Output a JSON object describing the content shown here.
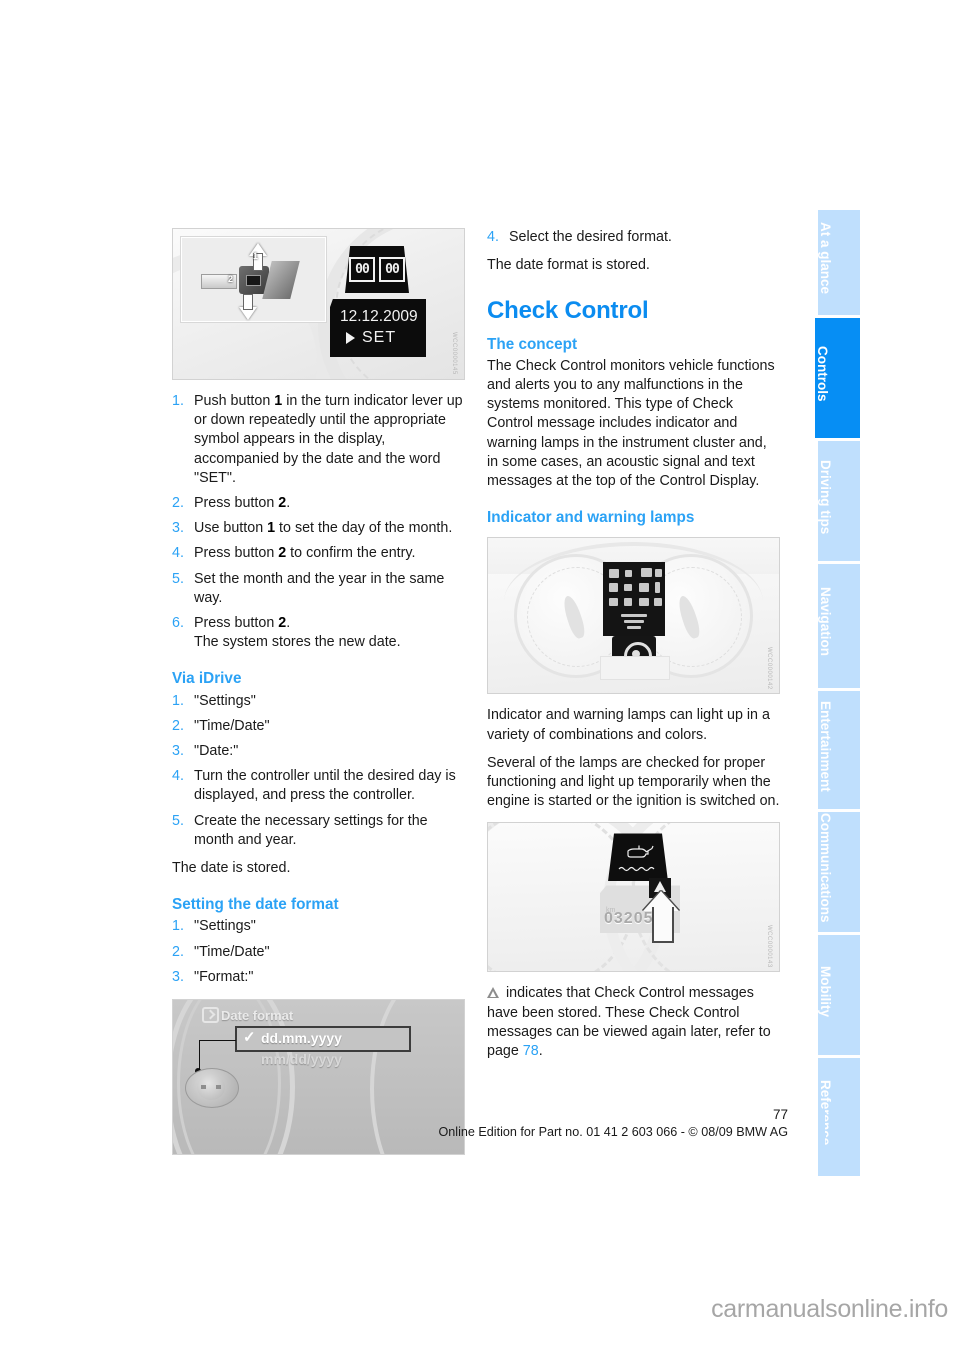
{
  "document": {
    "page_number": "77",
    "edition_line": "Online Edition for Part no. 01 41 2 603 066 - © 08/09 BMW AG",
    "watermark": "carmanualsonline.info"
  },
  "sidebar": {
    "tabs": [
      {
        "label": "At a glance",
        "active": false
      },
      {
        "label": "Controls",
        "active": true
      },
      {
        "label": "Driving tips",
        "active": false
      },
      {
        "label": "Navigation",
        "active": false
      },
      {
        "label": "Entertainment",
        "active": false
      },
      {
        "label": "Communications",
        "active": false
      },
      {
        "label": "Mobility",
        "active": false
      },
      {
        "label": "Reference",
        "active": false
      }
    ]
  },
  "left_column": {
    "figure_lever": {
      "name": "turn-indicator-lever-and-date-display",
      "callout_1": "1",
      "callout_2": "2",
      "lcd_segment_left": "00",
      "lcd_segment_right": "00",
      "lcd_date": "12.12.2009",
      "lcd_set": "SET",
      "credit_code": "WCC0000145"
    },
    "steps_manual": [
      {
        "num": "1.",
        "text": "Push button 1 in the turn indicator lever up or down repeatedly until the appropriate symbol appears in the display, accompanied by the date and the word \"SET\"."
      },
      {
        "num": "2.",
        "text": "Press button 2."
      },
      {
        "num": "3.",
        "text": "Use button 1 to set the day of the month."
      },
      {
        "num": "4.",
        "text": "Press button 2 to confirm the entry."
      },
      {
        "num": "5.",
        "text": "Set the month and the year in the same way."
      },
      {
        "num": "6.",
        "text": "Press button 2.",
        "sub": "The system stores the new date."
      }
    ],
    "via_idrive": {
      "heading": "Via iDrive",
      "steps": [
        {
          "num": "1.",
          "text": "\"Settings\""
        },
        {
          "num": "2.",
          "text": "\"Time/Date\""
        },
        {
          "num": "3.",
          "text": "\"Date:\""
        },
        {
          "num": "4.",
          "text": "Turn the controller until the desired day is displayed, and press the controller."
        },
        {
          "num": "5.",
          "text": "Create the necessary settings for the month and year."
        }
      ],
      "closing": "The date is stored."
    },
    "setting_date_format": {
      "heading": "Setting the date format",
      "steps": [
        {
          "num": "1.",
          "text": "\"Settings\""
        },
        {
          "num": "2.",
          "text": "\"Time/Date\""
        },
        {
          "num": "3.",
          "text": "\"Format:\""
        }
      ]
    },
    "figure_date_format": {
      "name": "date-format-menu",
      "title": "Date format",
      "option_selected": "dd.mm.yyyy",
      "option_other": "mm/dd/yyyy",
      "checkmark": "✓"
    }
  },
  "right_column": {
    "step_4": {
      "num": "4.",
      "text": "Select the desired format."
    },
    "after_step_4": "The date format is stored.",
    "check_control": {
      "heading": "Check Control",
      "concept_heading": "The concept",
      "concept_text": "The Check Control monitors vehicle functions and alerts you to any malfunctions in the systems monitored. This type of Check Control message includes indicator and warning lamps in the instrument cluster and, in some cases, an acoustic signal and text messages at the top of the Control Display."
    },
    "indicator_lamps": {
      "heading": "Indicator and warning lamps",
      "figure_cluster": {
        "name": "instrument-cluster",
        "credit_code": "WCC0000142"
      },
      "paragraph_1": "Indicator and warning lamps can light up in a variety of combinations and colors.",
      "paragraph_2": "Several of the lamps are checked for proper functioning and light up temporarily when the engine is started or the ignition is switched on.",
      "figure_oil": {
        "name": "oil-level-warning-lamp",
        "odometer": "032050",
        "credit_code": "WCC0000143"
      },
      "paragraph_3_pre": " indicates that Check Control messages have been stored. These Check Control messages can be viewed again later, refer to page ",
      "paragraph_3_link": "78",
      "paragraph_3_post": "."
    }
  },
  "colors": {
    "heading_blue": "#0b8cf0",
    "subheading_blue": "#2ba2f5",
    "tab_active": "#068ef4",
    "tab_inactive": "#bfdffd",
    "body_text": "#1a1a1a"
  }
}
